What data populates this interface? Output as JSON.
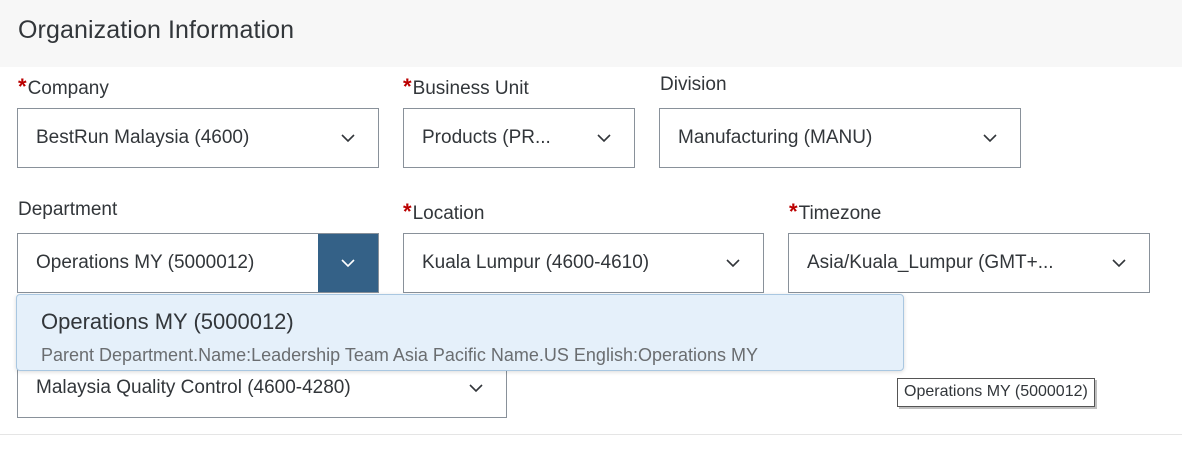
{
  "section": {
    "title": "Organization Information"
  },
  "fields": {
    "company": {
      "label": "Company",
      "required": "*",
      "value": "BestRun Malaysia (4600)"
    },
    "business_unit": {
      "label": "Business Unit",
      "required": "*",
      "value": "Products (PR..."
    },
    "division": {
      "label": "Division",
      "value": "Manufacturing (MANU)"
    },
    "department": {
      "label": "Department",
      "value": "Operations MY (5000012)"
    },
    "location": {
      "label": "Location",
      "required": "*",
      "value": "Kuala Lumpur (4600-4610)"
    },
    "timezone": {
      "label": "Timezone",
      "required": "*",
      "value": "Asia/Kuala_Lumpur (GMT+..."
    },
    "cost_center": {
      "value": "Malaysia Quality Control (4600-4280)"
    }
  },
  "dropdown": {
    "option_title": "Operations MY (5000012)",
    "option_subtitle": "Parent Department.Name:Leadership Team Asia Pacific Name.US English:Operations MY"
  },
  "tooltip": {
    "text": "Operations MY (5000012)"
  },
  "colors": {
    "accent": "#346187",
    "required": "#bb0000",
    "selected_bg": "#e5f0fa"
  },
  "icons": {
    "chevron": "chevron-down-icon"
  }
}
